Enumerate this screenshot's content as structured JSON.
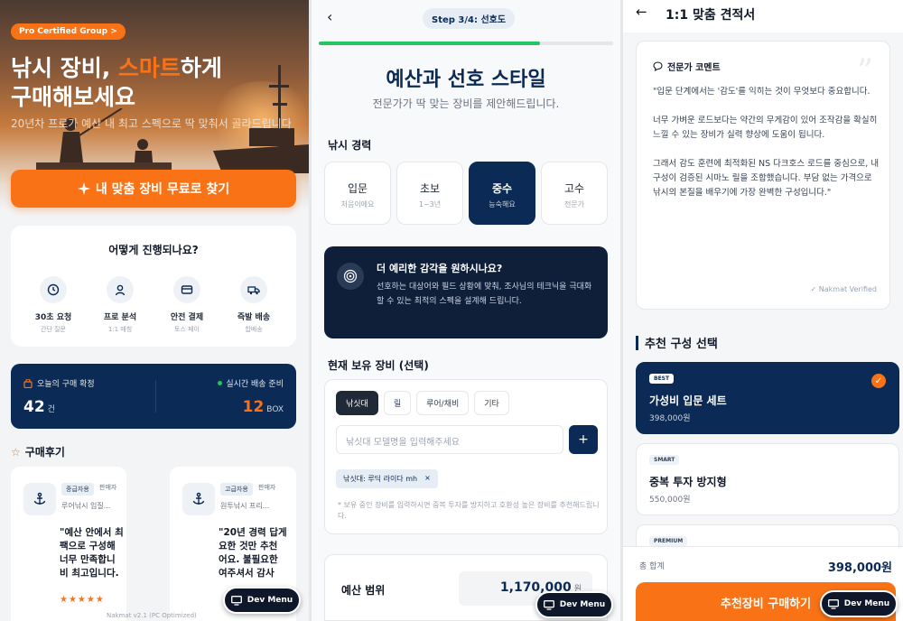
{
  "home": {
    "badge": "Pro Certified Group >",
    "headline_a": "낚시 장비, ",
    "headline_accent": "스마트",
    "headline_b": "하게",
    "headline_c": "구매해보세요",
    "subtitle": "20년차 프로가 예산 내 최고 스펙으로 딱 맞춰서 골라드립니다",
    "cta_label": "내 맞춤 장비 무료로 찾기",
    "process_title": "어떻게 진행되나요?",
    "steps": [
      {
        "title": "30초 요청",
        "sub": "간단 질문",
        "icon": "clock-icon"
      },
      {
        "title": "프로 분석",
        "sub": "1:1 매칭",
        "icon": "user-icon"
      },
      {
        "title": "안전 결제",
        "sub": "토스 페이",
        "icon": "card-icon"
      },
      {
        "title": "즉발 배송",
        "sub": "합배송",
        "icon": "truck-icon"
      }
    ],
    "stat_left_label": "오늘의 구매 확정",
    "stat_left_value": "42",
    "stat_left_unit": "건",
    "stat_right_label": "실시간 배송 준비",
    "stat_right_value": "12",
    "stat_right_unit": "BOX",
    "reviews_title": "구매후기",
    "reviews": [
      {
        "tag": "중급자용",
        "tag2": "판매자",
        "product": "루어낚시 입질...",
        "body": "\"예산 안에서 최\n팩으로 구성해\n너무 만족합니\n비 최고입니다.",
        "stars": "★★★★★"
      },
      {
        "tag": "고급자용",
        "tag2": "판매자",
        "product": "원투낚시 프리...",
        "body": "\"20년 경력 답게\n요한 것만 추천\n어요. 불필요한\n여주셔서 감사"
      }
    ],
    "version": "Nakmat v2.1 (PC Optimized)",
    "dev_menu": "Dev Menu"
  },
  "wizard": {
    "step_label": "Step 3/4: 선호도",
    "progress_pct": 75,
    "title": "예산과 선호 스타일",
    "subtitle": "전문가가 딱 맞는 장비를 제안해드립니다.",
    "exp_label": "낚시 경력",
    "levels": [
      {
        "a": "입문",
        "b": "처음이에요"
      },
      {
        "a": "초보",
        "b": "1~3년"
      },
      {
        "a": "중수",
        "b": "능숙해요"
      },
      {
        "a": "고수",
        "b": "전문가"
      }
    ],
    "tip_title": "더 예리한 감각을 원하시나요?",
    "tip_body": "선호하는 대상어와 필드 상황에 맞춰, 조사님의 테크닉을 극대화할 수 있는 최적의 스펙을 설계해 드립니다.",
    "gear_label": "현재 보유 장비 (선택)",
    "chips": [
      "낚싯대",
      "릴",
      "루어/채비",
      "기타"
    ],
    "input_placeholder": "낚싯대 모델명을 입력해주세요",
    "plus": "+",
    "gear_tag": "낚싯대: 루딕 라이다 mh",
    "gear_tag_x": "×",
    "note": "* 보유 중인 장비를 입력하시면 중복 투자를 방지하고 호환성 높은 장비를 추천해드립니다.",
    "budget_label": "예산 범위",
    "budget_value": "1,170,000",
    "budget_unit": "원",
    "dev_menu": "Dev Menu"
  },
  "quote": {
    "title": "1:1 맞춤 견적서",
    "comment_title": "전문가 코멘트",
    "comment": "\"입문 단계에서는 '감도'를 익히는 것이 무엇보다 중요합니다.\n\n너무 가벼운 로드보다는 약간의 무게감이 있어 조작감을 확실히 느낄 수 있는 장비가 실력 향상에 도움이 됩니다.\n\n그래서 감도 훈련에 최적화된 NS 다크호스 로드를 중심으로, 내구성이 검증된 시마노 릴을 조합했습니다. 부담 없는 가격으로 낚시의 본질을 배우기에 가장 완벽한 구성입니다.\"",
    "verified": "✓ Nakmat Verified",
    "rec_title": "추천 구성 선택",
    "options": [
      {
        "tag": "BEST",
        "name": "가성비 입문 세트",
        "price": "398,000원"
      },
      {
        "tag": "SMART",
        "name": "중복 투자 방지형",
        "price": "550,000원"
      },
      {
        "tag": "PREMIUM",
        "name": "",
        "price": ""
      }
    ],
    "total_label": "총 합계",
    "total_value": "398,000원",
    "buy_label": "추천장비 구매하기",
    "dev_menu": "Dev Menu"
  }
}
